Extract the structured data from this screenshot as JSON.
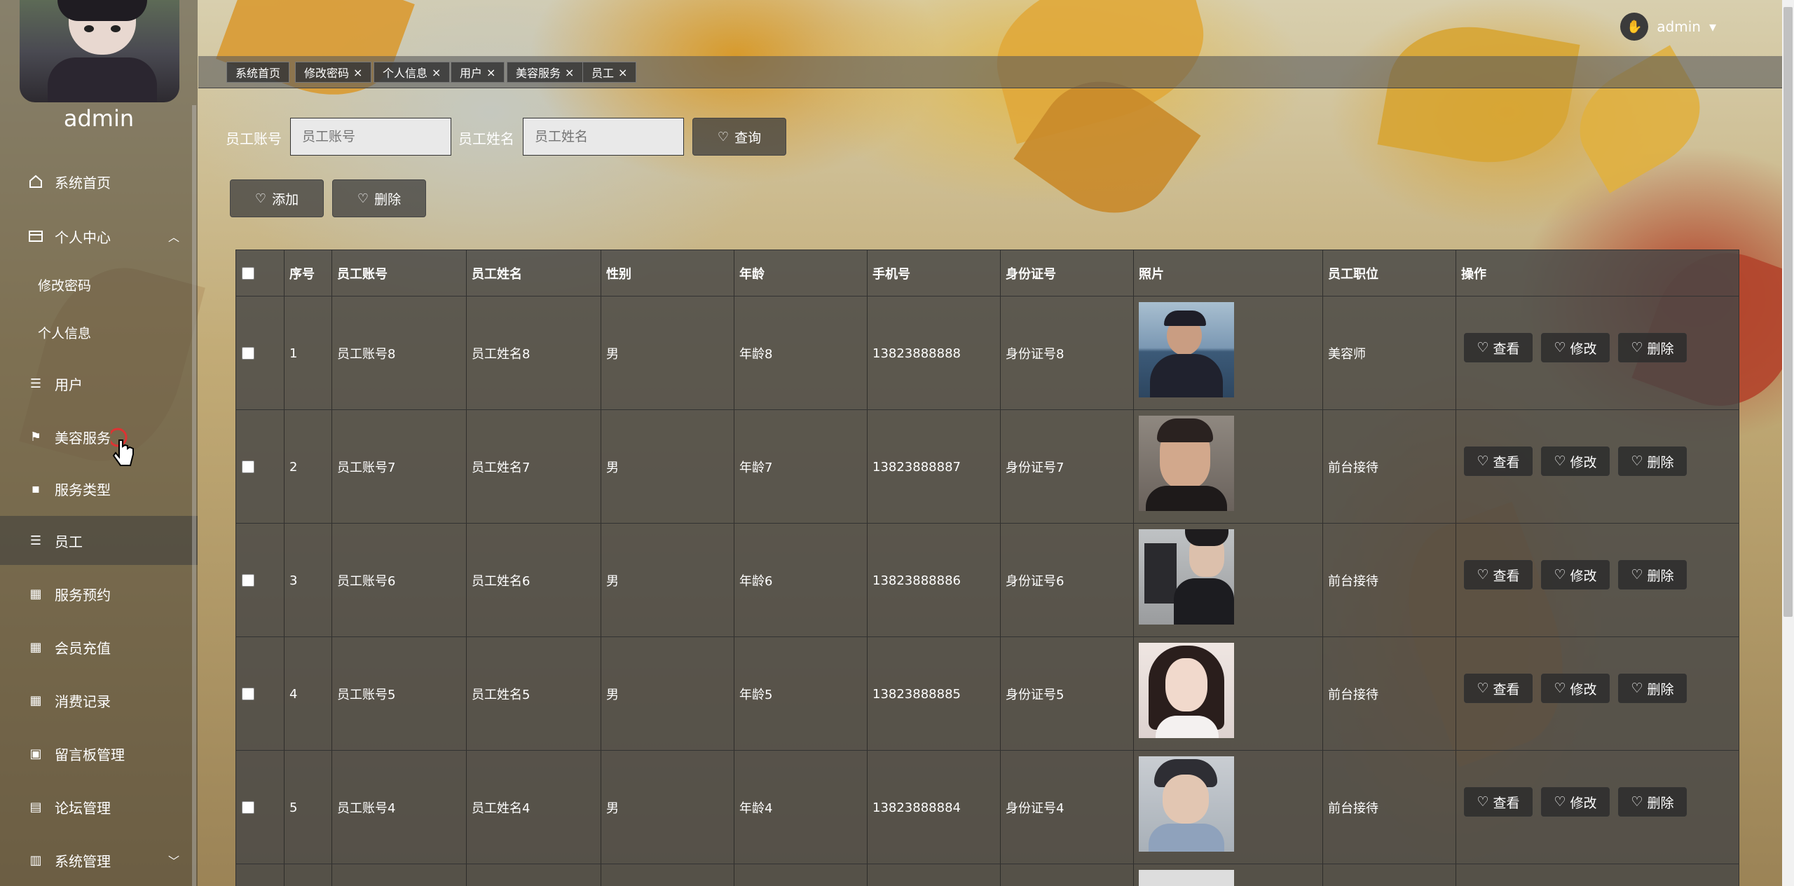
{
  "sidebar": {
    "username": "admin",
    "items": [
      {
        "label": "系统首页",
        "icon": "home-icon"
      },
      {
        "label": "个人中心",
        "icon": "card-icon"
      },
      {
        "label": "用户",
        "icon": "list-icon"
      },
      {
        "label": "美容服务",
        "icon": "flag-icon"
      },
      {
        "label": "服务类型",
        "icon": "chat-icon"
      },
      {
        "label": "员工",
        "icon": "list-icon"
      },
      {
        "label": "服务预约",
        "icon": "grid-icon"
      },
      {
        "label": "会员充值",
        "icon": "grid-icon"
      },
      {
        "label": "消费记录",
        "icon": "grid-icon"
      },
      {
        "label": "留言板管理",
        "icon": "printer-icon"
      },
      {
        "label": "论坛管理",
        "icon": "briefcase-icon"
      },
      {
        "label": "系统管理",
        "icon": "clipboard-icon"
      }
    ],
    "sub_items": [
      "修改密码",
      "个人信息"
    ]
  },
  "header": {
    "user": "admin"
  },
  "tags": [
    "系统首页",
    "修改密码",
    "个人信息",
    "用户",
    "美容服务",
    "员工"
  ],
  "search": {
    "label1": "员工账号",
    "placeholder1": "员工账号",
    "label2": "员工姓名",
    "placeholder2": "员工姓名",
    "query_label": "查询"
  },
  "actions": {
    "add": "添加",
    "delete": "删除"
  },
  "table": {
    "headers": [
      "序号",
      "员工账号",
      "员工姓名",
      "性别",
      "年龄",
      "手机号",
      "身份证号",
      "照片",
      "员工职位",
      "操作"
    ],
    "row_buttons": {
      "view": "查看",
      "edit": "修改",
      "delete": "删除"
    },
    "rows": [
      {
        "no": "1",
        "account": "员工账号8",
        "name": "员工姓名8",
        "gender": "男",
        "age": "年龄8",
        "phone": "13823888888",
        "idcard": "身份证号8",
        "position": "美容师"
      },
      {
        "no": "2",
        "account": "员工账号7",
        "name": "员工姓名7",
        "gender": "男",
        "age": "年龄7",
        "phone": "13823888887",
        "idcard": "身份证号7",
        "position": "前台接待"
      },
      {
        "no": "3",
        "account": "员工账号6",
        "name": "员工姓名6",
        "gender": "男",
        "age": "年龄6",
        "phone": "13823888886",
        "idcard": "身份证号6",
        "position": "前台接待"
      },
      {
        "no": "4",
        "account": "员工账号5",
        "name": "员工姓名5",
        "gender": "男",
        "age": "年龄5",
        "phone": "13823888885",
        "idcard": "身份证号5",
        "position": "前台接待"
      },
      {
        "no": "5",
        "account": "员工账号4",
        "name": "员工姓名4",
        "gender": "男",
        "age": "年龄4",
        "phone": "13823888884",
        "idcard": "身份证号4",
        "position": "前台接待"
      }
    ]
  }
}
